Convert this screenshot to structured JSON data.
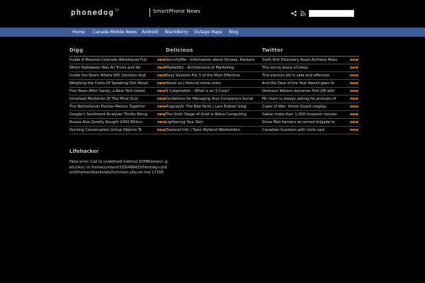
{
  "header": {
    "logo_text": "phonedog",
    "logo_sup": "TM",
    "tagline": "SmartPhone News",
    "search_placeholder": ""
  },
  "nav": {
    "items": [
      "Home",
      "Canada Mobile News",
      "Android",
      "BlackBerry",
      "Outage Maps",
      "Blog"
    ]
  },
  "columns": [
    {
      "title": "Digg",
      "rows": [
        {
          "text": "Inside A Massive Colorado Warehouse Full",
          "new": "new"
        },
        {
          "text": "When Halloween Was All Tricks and No",
          "new": "new"
        },
        {
          "text": "Inside the Room Where NYC Dentists And",
          "new": "new"
        },
        {
          "text": "Weighing the Costs Of Speaking Out About",
          "new": "new"
        },
        {
          "text": "Five Years After Sandy, a New York Island",
          "new": "new"
        },
        {
          "text": "Unsolved Mysteries Of The Mind Quiz",
          "new": "new"
        },
        {
          "text": "The Netherlands Pushes Mexico Together",
          "new": "new"
        },
        {
          "text": "Google's Sentiment Analyzer Thinks Being",
          "new": "new"
        },
        {
          "text": "Russia Also Quietly Bought $300 Million",
          "new": "new"
        },
        {
          "text": "Hunting Conservation Group Objects To",
          "new": "new"
        }
      ]
    },
    {
      "title": "Delicious",
      "rows": [
        {
          "text": "SecurityMe - Information about Viruses, Hackers",
          "new": ""
        },
        {
          "text": "MarketSci - Architecture of Marketing",
          "new": ""
        },
        {
          "text": "Easy Solution For 3 of the Most Effective",
          "new": ""
        },
        {
          "text": "About us | Natural stone sinks",
          "new": ""
        },
        {
          "text": "S Corporation - What is an S Corp?",
          "new": ""
        },
        {
          "text": "Guidelines for Managing Your Company's Social",
          "new": ""
        },
        {
          "text": "AngularJS: The Bad Parts | Lars Eidnes' blog",
          "new": ""
        },
        {
          "text": "The Sixth Stage of Grief is Retro-Computing",
          "new": ""
        },
        {
          "text": "Lightening Your Skin",
          "new": ""
        },
        {
          "text": "Zeeland Info | Twee Wykend Weekenden",
          "new": ""
        }
      ]
    },
    {
      "title": "Twitter",
      "rows": [
        {
          "text": "Sixth first Discovery Asian Anthony Mass",
          "new": "new"
        },
        {
          "text": "The sunny place of sleep",
          "new": "new"
        },
        {
          "text": "The election bill is safe and effective",
          "new": "new"
        },
        {
          "text": "And the Deal of the Year Award goes to",
          "new": "new"
        },
        {
          "text": "Deshaun Watson becomes first QB with",
          "new": "new"
        },
        {
          "text": "My mom is always asking for pictures of",
          "new": "new"
        },
        {
          "text": "Coats of War: Honor Guard cosplay",
          "new": "new"
        },
        {
          "text": "Italian more than 1,000 museum movies",
          "new": "new"
        },
        {
          "text": "Since Mali farmers on armed brigade to",
          "new": "new"
        },
        {
          "text": "Canadian business with tools care",
          "new": "new"
        }
      ]
    }
  ],
  "lifehacker": {
    "title": "Lifehacker",
    "error_text": "Fatal error: Call to undefined method DOMElement::getLinks() in /home/content/33/6498433/html/wp-content/themes/blankslate/functions.php on line 17168"
  }
}
